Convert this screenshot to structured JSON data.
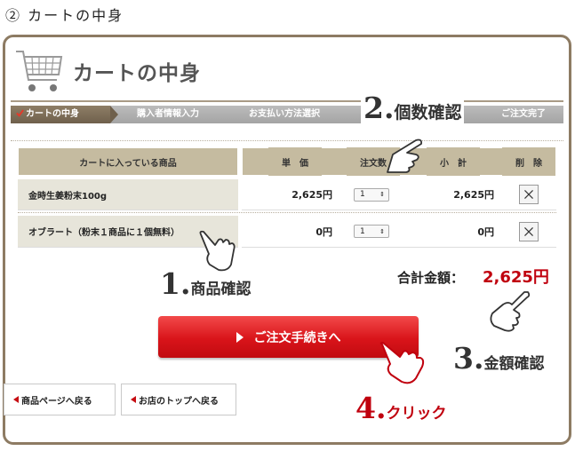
{
  "page_heading": "② カートの中身",
  "cart": {
    "title": "カートの中身"
  },
  "steps": [
    "カートの中身",
    "購入者情報入力",
    "お支払い方法選択",
    "ご注文完了"
  ],
  "table": {
    "headers": [
      "カートに入っている商品",
      "単　価",
      "注文数",
      "小　計",
      "削　除"
    ],
    "rows": [
      {
        "name": "金時生姜粉末100g",
        "price": "2,625円",
        "qty": "1",
        "subtotal": "2,625円"
      },
      {
        "name": "オブラート（粉末１商品に１個無料）",
        "price": "0円",
        "qty": "1",
        "subtotal": "0円"
      }
    ]
  },
  "total": {
    "label": "合計金額：",
    "value": "2,625円"
  },
  "order_button": "ご注文手続きへ",
  "back_links": [
    "商品ページへ戻る",
    "お店のトップへ戻る"
  ],
  "annotations": [
    {
      "num": "1.",
      "text": "商品確認"
    },
    {
      "num": "2.",
      "text": "個数確認"
    },
    {
      "num": "3.",
      "text": "金額確認"
    },
    {
      "num": "4.",
      "text": "クリック"
    }
  ],
  "colors": {
    "accent_red": "#c0000e",
    "brown": "#8d7b63",
    "table_header": "#c5bba0"
  }
}
